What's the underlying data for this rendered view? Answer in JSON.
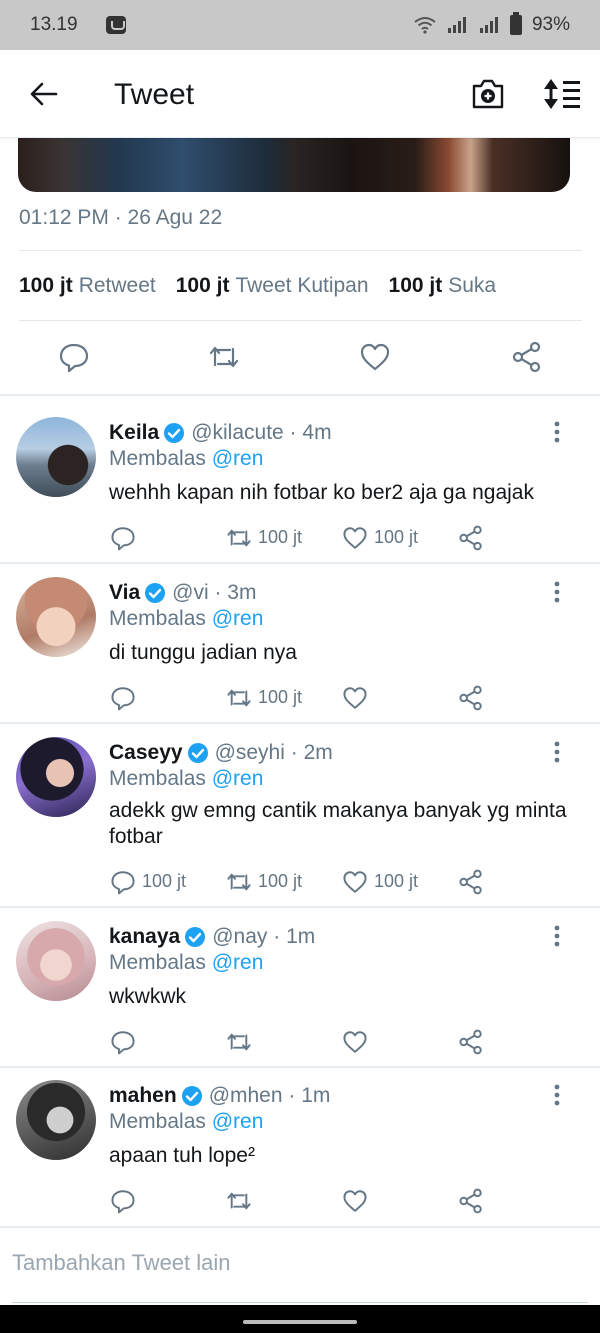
{
  "statusbar": {
    "time": "13.19",
    "battery": "93%"
  },
  "appbar": {
    "title": "Tweet"
  },
  "tweet": {
    "timestamp": "01:12 PM · 26 Agu 22",
    "stats": [
      {
        "count": "100 jt",
        "label": "Retweet"
      },
      {
        "count": "100 jt",
        "label": "Tweet Kutipan"
      },
      {
        "count": "100 jt",
        "label": "Suka"
      }
    ]
  },
  "colors": {
    "accent": "#1da1f2",
    "secondary_text": "#657786",
    "icon": "#657786"
  },
  "replies": [
    {
      "name": "Keila",
      "handle": "@kilacute · 4m",
      "replying_prefix": "Membalas",
      "mention": "@ren",
      "text": "wehhh kapan nih fotbar ko ber2 aja ga ngajak",
      "reply_count": "",
      "retweet_count": "100 jt",
      "like_count": "100 jt"
    },
    {
      "name": "Via",
      "handle": "@vi · 3m",
      "replying_prefix": "Membalas",
      "mention": "@ren",
      "text": "di tunggu jadian nya",
      "reply_count": "",
      "retweet_count": "100 jt",
      "like_count": ""
    },
    {
      "name": "Caseyy",
      "handle": "@seyhi · 2m",
      "replying_prefix": "Membalas",
      "mention": "@ren",
      "text": "adekk gw emng cantik makanya banyak yg minta fotbar",
      "reply_count": "100 jt",
      "retweet_count": "100 jt",
      "like_count": "100 jt"
    },
    {
      "name": "kanaya",
      "handle": "@nay · 1m",
      "replying_prefix": "Membalas",
      "mention": "@ren",
      "text": "wkwkwk",
      "reply_count": "",
      "retweet_count": "",
      "like_count": ""
    },
    {
      "name": "mahen",
      "handle": "@mhen · 1m",
      "replying_prefix": "Membalas",
      "mention": "@ren",
      "text": "apaan tuh lope²",
      "reply_count": "",
      "retweet_count": "",
      "like_count": ""
    }
  ],
  "compose": {
    "placeholder": "Tambahkan Tweet lain"
  }
}
